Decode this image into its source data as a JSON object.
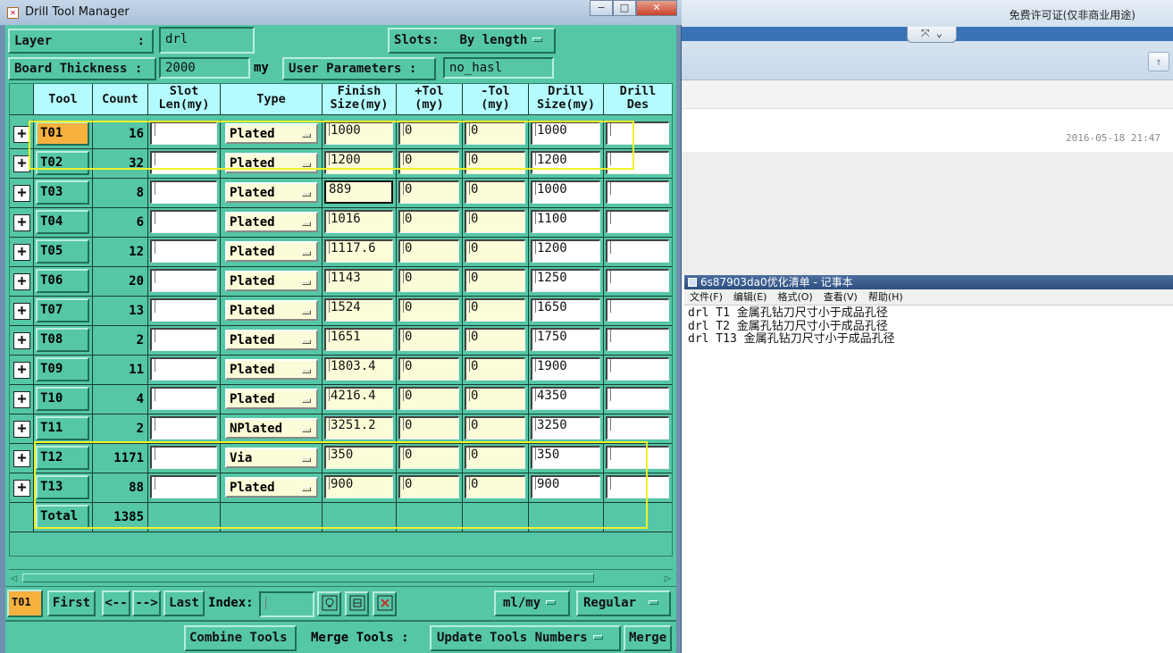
{
  "window": {
    "title": "Drill Tool Manager",
    "minimize": "−",
    "maximize": "□",
    "close": "✕"
  },
  "header": {
    "layer_label": "Layer",
    "layer_sep": ":",
    "layer_value": "drl",
    "slots_label": "Slots:",
    "slots_value": "By length",
    "thickness_label": "Board Thickness :",
    "thickness_value": "2000",
    "thickness_unit": "my",
    "user_params_label": "User Parameters :",
    "user_params_value": "no_hasl"
  },
  "table": {
    "columns": [
      {
        "line1": "Tool",
        "line2": ""
      },
      {
        "line1": "Count",
        "line2": ""
      },
      {
        "line1": "Slot",
        "line2": "Len(my)"
      },
      {
        "line1": "Type",
        "line2": ""
      },
      {
        "line1": "Finish",
        "line2": "Size(my)"
      },
      {
        "line1": "+Tol",
        "line2": "(my)"
      },
      {
        "line1": "-Tol",
        "line2": "(my)"
      },
      {
        "line1": "Drill",
        "line2": "Size(my)"
      },
      {
        "line1": "Drill",
        "line2": "Des"
      }
    ],
    "rows": [
      {
        "tool": "T01",
        "count": "16",
        "slot": "",
        "type": "Plated",
        "finish": "1000",
        "ptol": "0",
        "mtol": "0",
        "drill": "1000",
        "des": ""
      },
      {
        "tool": "T02",
        "count": "32",
        "slot": "",
        "type": "Plated",
        "finish": "1200",
        "ptol": "0",
        "mtol": "0",
        "drill": "1200",
        "des": ""
      },
      {
        "tool": "T03",
        "count": "8",
        "slot": "",
        "type": "Plated",
        "finish": "889",
        "ptol": "0",
        "mtol": "0",
        "drill": "1000",
        "des": ""
      },
      {
        "tool": "T04",
        "count": "6",
        "slot": "",
        "type": "Plated",
        "finish": "1016",
        "ptol": "0",
        "mtol": "0",
        "drill": "1100",
        "des": ""
      },
      {
        "tool": "T05",
        "count": "12",
        "slot": "",
        "type": "Plated",
        "finish": "1117.6",
        "ptol": "0",
        "mtol": "0",
        "drill": "1200",
        "des": ""
      },
      {
        "tool": "T06",
        "count": "20",
        "slot": "",
        "type": "Plated",
        "finish": "1143",
        "ptol": "0",
        "mtol": "0",
        "drill": "1250",
        "des": ""
      },
      {
        "tool": "T07",
        "count": "13",
        "slot": "",
        "type": "Plated",
        "finish": "1524",
        "ptol": "0",
        "mtol": "0",
        "drill": "1650",
        "des": ""
      },
      {
        "tool": "T08",
        "count": "2",
        "slot": "",
        "type": "Plated",
        "finish": "1651",
        "ptol": "0",
        "mtol": "0",
        "drill": "1750",
        "des": ""
      },
      {
        "tool": "T09",
        "count": "11",
        "slot": "",
        "type": "Plated",
        "finish": "1803.4",
        "ptol": "0",
        "mtol": "0",
        "drill": "1900",
        "des": ""
      },
      {
        "tool": "T10",
        "count": "4",
        "slot": "",
        "type": "Plated",
        "finish": "4216.4",
        "ptol": "0",
        "mtol": "0",
        "drill": "4350",
        "des": ""
      },
      {
        "tool": "T11",
        "count": "2",
        "slot": "",
        "type": "NPlated",
        "finish": "3251.2",
        "ptol": "0",
        "mtol": "0",
        "drill": "3250",
        "des": ""
      },
      {
        "tool": "T12",
        "count": "1171",
        "slot": "",
        "type": "Via",
        "finish": "350",
        "ptol": "0",
        "mtol": "0",
        "drill": "350",
        "des": ""
      },
      {
        "tool": "T13",
        "count": "88",
        "slot": "",
        "type": "Plated",
        "finish": "900",
        "ptol": "0",
        "mtol": "0",
        "drill": "900",
        "des": ""
      }
    ],
    "total_label": "Total",
    "total_count": "1385",
    "expander_glyph": "+"
  },
  "nav": {
    "current_tool": "T01",
    "first": "First",
    "prev": "<--",
    "next": "-->",
    "last": "Last",
    "index_label": "Index:",
    "index_value": "",
    "units": "ml/my",
    "mode": "Regular"
  },
  "actions": {
    "combine": "Combine Tools",
    "merge_label": "Merge Tools :",
    "update": "Update Tools Numbers",
    "merge": "Merge"
  },
  "background": {
    "license": "免费许可证(仅非商业用途)",
    "date": "2016-05-18 21:47",
    "ribbon_tab": "⤧ ⌄",
    "up_icon": "↑"
  },
  "notepad": {
    "title": "6s87903da0优化清单 - 记事本",
    "menus": [
      "文件(F)",
      "编辑(E)",
      "格式(O)",
      "查看(V)",
      "帮助(H)"
    ],
    "lines": [
      "drl T1 金属孔钻刀尺寸小于成品孔径",
      "drl T2 金属孔钻刀尺寸小于成品孔径",
      "drl T13 金属孔钻刀尺寸小于成品孔径"
    ]
  },
  "colors": {
    "motif_bg": "#55c7a6",
    "header_bg": "#b3fbfd",
    "field_cream": "#fcfcd8",
    "selected_tool": "#f7b13f",
    "highlight": "#f1f12a"
  }
}
